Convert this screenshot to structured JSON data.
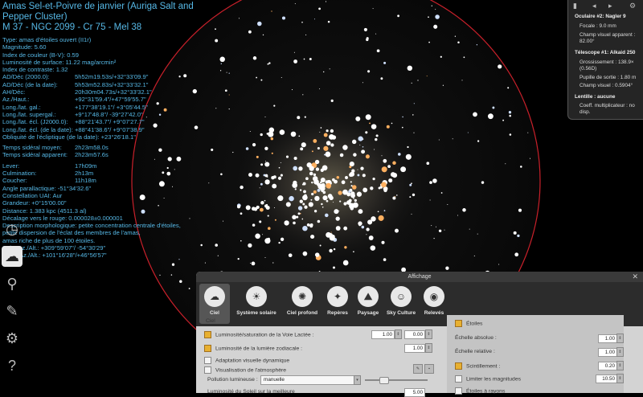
{
  "object": {
    "title1": "Amas Sel-et-Poivre de janvier (Auriga Salt and Pepper Cluster)",
    "title2": "M 37 - NGC 2099 - Cr 75 - Mel 38",
    "lines": [
      "Type: amas d'étoiles ouvert (II1r)",
      "Magnitude: 5.60",
      "Index de couleur (B-V): 0.59",
      "Luminosité de surface: 11.22 mag/arcmin²",
      "Index de contraste: 1.32"
    ],
    "coords": [
      {
        "k": "AD/Déc (2000.0):",
        "v": "5h52m19.53s/+32°33'09.9\""
      },
      {
        "k": "AD/Déc (de la date):",
        "v": "5h53m52.83s/+32°33'32.1\""
      },
      {
        "k": "AH/Déc:",
        "v": "20h30m04.73s/+32°33'32.1\""
      },
      {
        "k": "Az./Haut.:",
        "v": "+92°31'59.4\"/+47°59'55.7\""
      },
      {
        "k": "Long./lat. gal.:",
        "v": "+177°38'19.1\"/ +3°05'44.5\""
      },
      {
        "k": "Long./lat. supergal.:",
        "v": "+9°17'48.8\"/ -39°27'42.0\""
      },
      {
        "k": "Long./lat. écl. (J2000.0):",
        "v": "+88°21'43.7\"/ +9°07'27.7\""
      },
      {
        "k": "Long./lat. écl. (de la date):",
        "v": "+88°41'38.6\"/ +9°07'38.9\""
      }
    ],
    "obliquity": "Obliquité de l'écliptique (de la date): +23°26'18.1\"",
    "times": [
      {
        "k": "Temps sidéral moyen:",
        "v": "2h23m58.0s"
      },
      {
        "k": "Temps sidéral apparent:",
        "v": "2h23m57.6s"
      }
    ],
    "events": [
      {
        "k": "Lever:",
        "v": "17h09m"
      },
      {
        "k": "Culmination:",
        "v": "2h13m"
      },
      {
        "k": "Coucher:",
        "v": "11h18m"
      }
    ],
    "tail": [
      "Angle parallactique: -51°34'32.6\"",
      "Constellation UAI: Aur",
      "Grandeur: +0°15'00.00\"",
      "Distance: 1.383 kpc (4511.3 al)",
      "Décalage vers le rouge: 0.000028±0.000001",
      "Description morphologique: petite concentration centrale d'étoiles,",
      "petite dispersion de l'éclat des membres de l'amas,",
      "amas riche de plus de 100 étoiles.",
      "Solar Az./Alt.: +309°59'07\"/ -54°30'29\"",
      "Lunar Az./Alt.: +101°16'28\"/+46°56'57\""
    ]
  },
  "ocular_panel": {
    "ocular_title": "Oculaire #2: Nagler 9",
    "focal": "Focale : 9.0 mm",
    "fov_label": "Champ visuel apparent :",
    "fov_value": "82.00°",
    "telescope_title": "Télescope #1: Alkaid 250",
    "magnif": "Grossissement : 138.9×",
    "magnif2": "(0.56D)",
    "exit_pupil": "Pupille de sortie : 1.80 m",
    "fov_real": "Champ visuel : 0.5904°",
    "lens_title": "Lentille : aucune",
    "coef": "Coeff. multiplicateur : no",
    "disp": "disp."
  },
  "dialog": {
    "title": "Affichage",
    "tabs": [
      {
        "label": "Ciel",
        "icon": "sky-icon",
        "glyph": "☁"
      },
      {
        "label": "Système solaire",
        "icon": "solar-system-icon",
        "glyph": "☀"
      },
      {
        "label": "Ciel profond",
        "icon": "galaxy-icon",
        "glyph": "✺"
      },
      {
        "label": "Repères",
        "icon": "markings-icon",
        "glyph": "✦"
      },
      {
        "label": "Paysage",
        "icon": "landscape-icon",
        "glyph": "⛰"
      },
      {
        "label": "Sky Culture",
        "icon": "sky-culture-icon",
        "glyph": "☺"
      },
      {
        "label": "Relevés",
        "icon": "surveys-icon",
        "glyph": "◉"
      }
    ],
    "left_section": "Ciel",
    "milky_way": "Luminosité/saturation de la Voie Lactée :",
    "milky_val1": "1.00",
    "milky_val2": "0.00",
    "zodiacal": "Luminosité de la lumière zodiacale :",
    "zodiacal_val": "1.00",
    "adaptation": "Adaptation visuelle dynamique",
    "atmosphere": "Visualisation de l'atmosphère",
    "pollution_label": "Pollution lumineuse :",
    "pollution_value": "manuelle",
    "bottom_cut": "Luminosité du Soleil sur la meilleure",
    "bottom_val": "5.00",
    "right_section": "Étoiles",
    "abs_scale": "Échelle absolue :",
    "abs_val": "1.00",
    "rel_scale": "Échelle relative :",
    "rel_val": "1.00",
    "twinkle": "Scintillement :",
    "twinkle_val": "0.20",
    "limit_mag": "Limiter les magnitudes",
    "limit_val": "10.50",
    "spikes": "Étoiles à rayons"
  },
  "colors": {
    "info_text": "#56b8e6",
    "ocular_circle": "#c8202a",
    "checkbox_on": "#e8b030"
  }
}
